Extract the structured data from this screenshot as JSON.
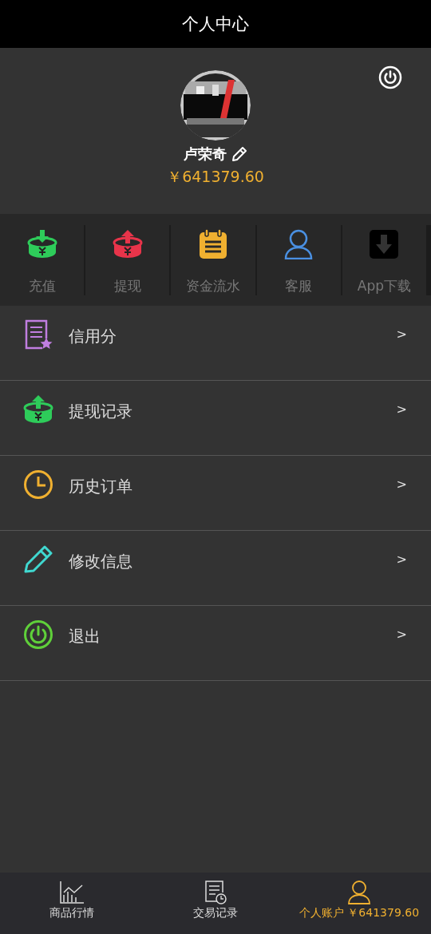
{
  "header": {
    "title": "个人中心"
  },
  "profile": {
    "name": "卢荣奇",
    "balance": "￥641379.60"
  },
  "actions": [
    {
      "label": "充值",
      "kind": "deposit"
    },
    {
      "label": "提现",
      "kind": "withdraw"
    },
    {
      "label": "资金流水",
      "kind": "ledger"
    },
    {
      "label": "客服",
      "kind": "service"
    },
    {
      "label": "App下载",
      "kind": "download"
    }
  ],
  "menu": [
    {
      "label": "信用分",
      "kind": "credit",
      "arrow": ">"
    },
    {
      "label": "提现记录",
      "kind": "withdraw",
      "arrow": ">"
    },
    {
      "label": "历史订单",
      "kind": "history",
      "arrow": ">"
    },
    {
      "label": "修改信息",
      "kind": "edit",
      "arrow": ">"
    },
    {
      "label": "退出",
      "kind": "logout",
      "arrow": ">"
    }
  ],
  "tabs": [
    {
      "label": "商品行情",
      "kind": "market",
      "selected": false
    },
    {
      "label": "交易记录",
      "kind": "records",
      "selected": false
    },
    {
      "label": "个人账户 ￥641379.60",
      "kind": "account",
      "selected": true
    }
  ]
}
